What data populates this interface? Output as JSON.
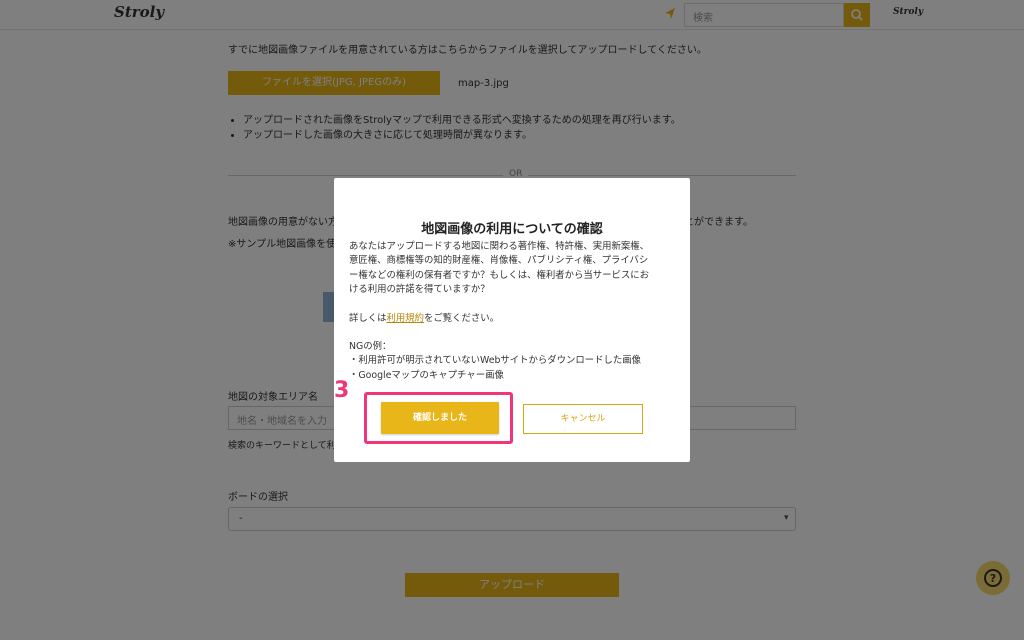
{
  "header": {
    "logo": "Stroly",
    "search_placeholder": "検索",
    "right_logo": "Stroly"
  },
  "page": {
    "intro": "すでに地図画像ファイルを用意されている方はこちらからファイルを選択してアップロードしてください。",
    "file_button": "ファイルを選択(JPG, JPEGのみ)",
    "file_name": "map-3.jpg",
    "notes": [
      "アップロードされた画像をStrolyマップで利用できる形式へ変換するための処理を再び行います。",
      "アップロードした画像の大きさに応じて処理時間が異なります。"
    ],
    "or_label": "OR",
    "desc1": "地図画像の用意がない方",
    "desc1_tail": "とができます。",
    "desc2": "※サンプル地図画像を使",
    "area_label": "地図の対象エリア名",
    "area_placeholder": "地名・地域名を入力",
    "area_help": "検索のキーワードとして利用",
    "board_label": "ボードの選択",
    "board_value": "-",
    "upload_button": "アップロード"
  },
  "modal": {
    "title": "地図画像の利用についての確認",
    "body": [
      "あなたはアップロードする地図に関わる著作権、特許権、実用新案権、",
      "意匠権、商標権等の知的財産権、肖像権、パブリシティ権、プライバシ",
      "ー権などの権利の保有者ですか？もしくは、権利者から当サービスにお",
      "ける利用の許諾を得ていますか？"
    ],
    "detail_prefix": "詳しくは",
    "detail_link": "利用規約",
    "detail_suffix": "をご覧ください。",
    "ng_title": "NGの例：",
    "ng_items": [
      "・利用許可が明示されていないWebサイトからダウンロードした画像",
      "・Googleマップのキャプチャー画像"
    ],
    "confirm_button": "確認しました",
    "cancel_button": "キャンセル"
  },
  "annotation": {
    "step_number": "3",
    "color": "#f0357a"
  },
  "icons": [
    "location-arrow-icon",
    "search-icon",
    "help-icon"
  ],
  "colors": {
    "accent": "#e8b619",
    "overlay": "rgba(0,0,0,0.5)"
  }
}
